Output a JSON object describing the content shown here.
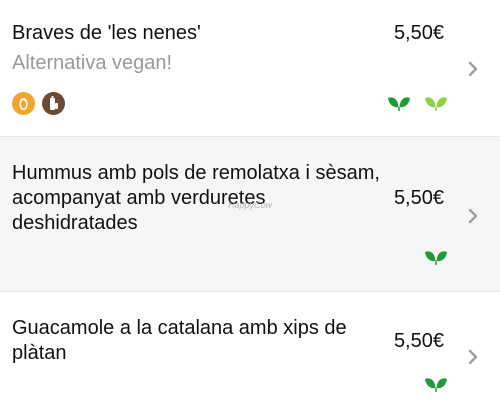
{
  "menu": {
    "items": [
      {
        "name": "Braves de 'les nenes'",
        "subtitle": "Alternativa vegan!",
        "price": "5,50€",
        "allergens": [
          "egg-icon",
          "allergen-icon"
        ],
        "diet_icons": [
          "vegan-leaf-icon",
          "vegetarian-leaf-icon"
        ]
      },
      {
        "name": "Hummus amb pols de remolatxa i sèsam, acompanyat amb verduretes deshidratades",
        "price": "5,50€",
        "diet_icons": [
          "vegan-leaf-icon"
        ]
      },
      {
        "name": "Guacamole a la catalana amb xips de plàtan",
        "price": "5,50€",
        "diet_icons": [
          "vegan-leaf-icon"
        ]
      }
    ]
  },
  "watermark": "HappyCow",
  "colors": {
    "vegan_leaf": "#1f9a3a",
    "vegetarian_leaf": "#8fd13f",
    "egg_badge": "#f2a42b",
    "allergen_badge": "#6b4b35",
    "chevron": "#9d9d9d",
    "alt_row_bg": "#f6f6f6"
  }
}
